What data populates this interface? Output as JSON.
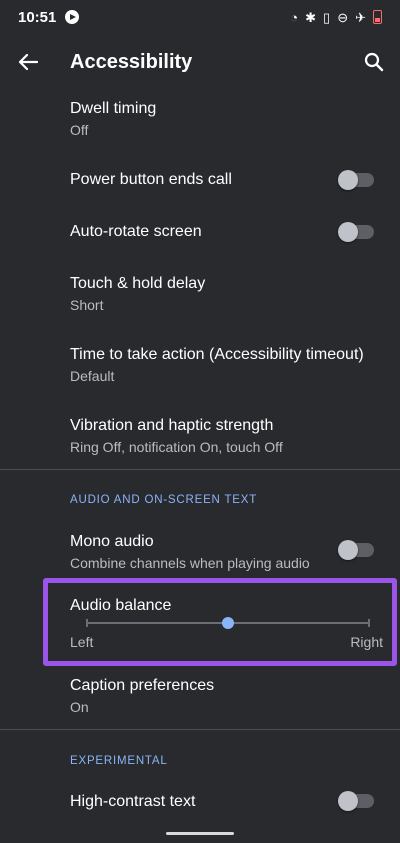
{
  "status_bar": {
    "time": "10:51"
  },
  "app_bar": {
    "title": "Accessibility"
  },
  "items": {
    "dwell_timing": {
      "title": "Dwell timing",
      "subtitle": "Off"
    },
    "power_button": {
      "title": "Power button ends call",
      "enabled": false
    },
    "auto_rotate": {
      "title": "Auto-rotate screen",
      "enabled": false
    },
    "touch_hold": {
      "title": "Touch & hold delay",
      "subtitle": "Short"
    },
    "time_action": {
      "title": "Time to take action (Accessibility timeout)",
      "subtitle": "Default"
    },
    "vibration": {
      "title": "Vibration and haptic strength",
      "subtitle": "Ring Off, notification On, touch Off"
    },
    "mono_audio": {
      "title": "Mono audio",
      "subtitle": "Combine channels when playing audio",
      "enabled": false
    },
    "audio_balance": {
      "title": "Audio balance",
      "left_label": "Left",
      "right_label": "Right",
      "value": 0.5
    },
    "caption": {
      "title": "Caption preferences",
      "subtitle": "On"
    },
    "high_contrast": {
      "title": "High-contrast text",
      "enabled": false
    }
  },
  "sections": {
    "audio": "AUDIO AND ON-SCREEN TEXT",
    "experimental": "EXPERIMENTAL"
  },
  "colors": {
    "accent": "#8ab4f8",
    "highlight": "#9a55e8",
    "background": "#292a2e"
  }
}
